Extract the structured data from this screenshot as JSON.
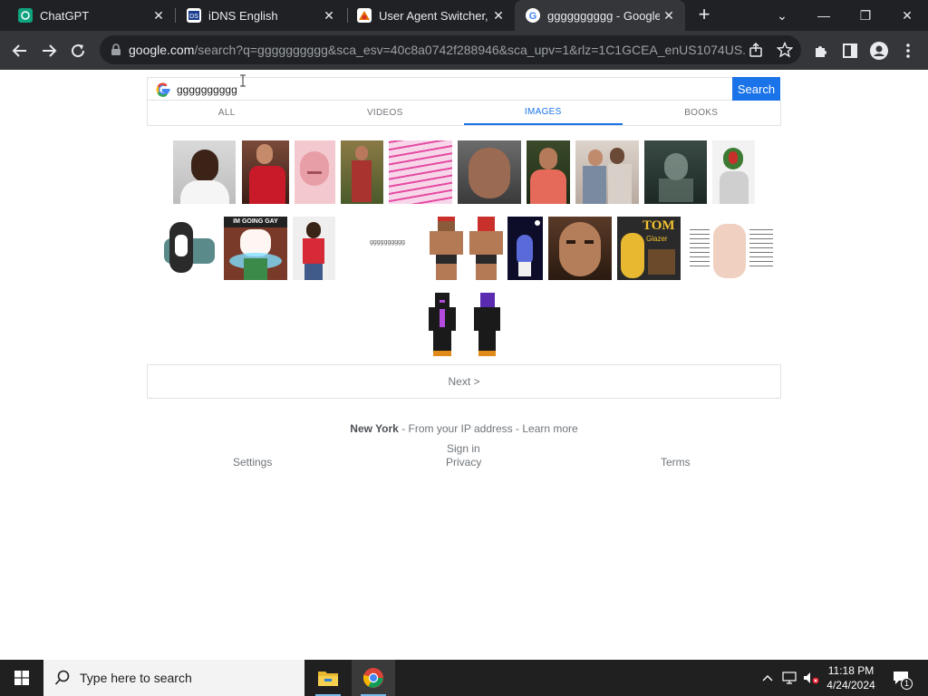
{
  "browser": {
    "tabs": [
      {
        "title": "ChatGPT",
        "close": "✕"
      },
      {
        "title": "iDNS English",
        "close": "✕"
      },
      {
        "title": "User Agent Switcher, U",
        "close": "✕"
      },
      {
        "title": "gggggggggg - Google",
        "close": "✕"
      }
    ],
    "new_tab": "+",
    "window": {
      "chevron": "⌄",
      "minimize": "—",
      "restore": "❐",
      "close": "✕"
    },
    "url_host": "google.com",
    "url_rest": "/search?q=gggggggggg&sca_esv=40c8a0742f288946&sca_upv=1&rlz=1C1GCEA_enUS1074US..."
  },
  "search": {
    "query": "gggggggggg",
    "button": "Search",
    "tabs": [
      "ALL",
      "VIDEOS",
      "IMAGES",
      "BOOKS"
    ],
    "active_tab": "IMAGES"
  },
  "results": {
    "text_thumb": "gggggggggg",
    "thumb_captions": {
      "im_going_gay": "IM GOING GAY",
      "tom_glazer": "TOM",
      "tom_glazer_sub": "Glazer"
    },
    "next": "Next >"
  },
  "footer": {
    "location_city": "New York",
    "location_rest": " - From your IP address - Learn more",
    "sign_in": "Sign in",
    "settings": "Settings",
    "privacy": "Privacy",
    "terms": "Terms"
  },
  "taskbar": {
    "search_placeholder": "Type here to search",
    "time": "11:18 PM",
    "date": "4/24/2024",
    "notif_count": "1"
  },
  "colors": {
    "accent": "#1a73e8",
    "chrome_dark": "#202124",
    "chrome_toolbar": "#35363a",
    "taskbar": "#202020"
  }
}
